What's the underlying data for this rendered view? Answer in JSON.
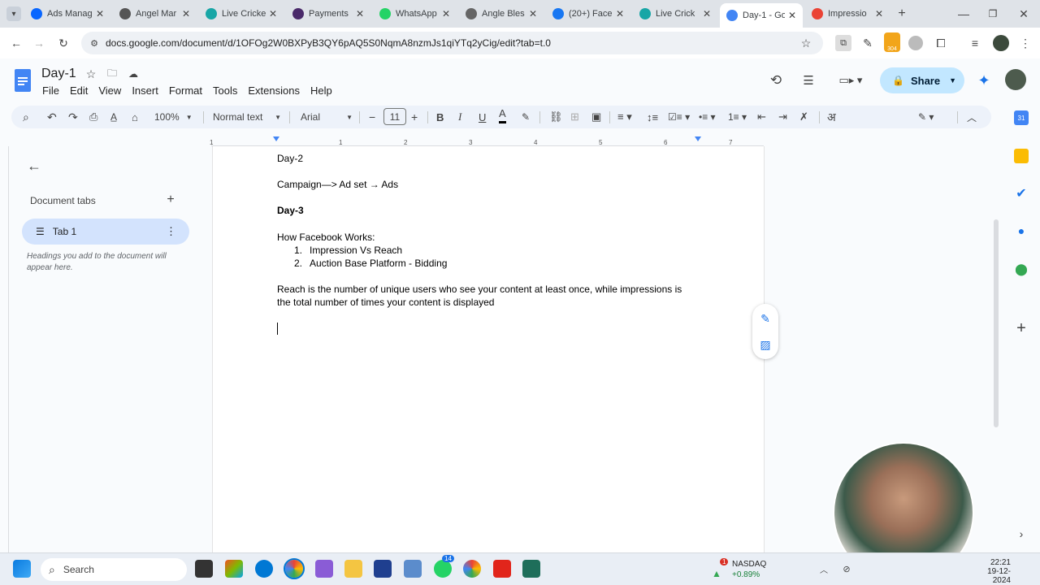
{
  "browser": {
    "tabs": [
      {
        "title": "Ads Manag",
        "color": "#0866ff"
      },
      {
        "title": "Angel Mar",
        "color": "#555"
      },
      {
        "title": "Live Cricke",
        "color": "#18a6a6"
      },
      {
        "title": "Payments",
        "color": "#4a2a6a"
      },
      {
        "title": "WhatsApp",
        "color": "#25d366"
      },
      {
        "title": "Angle Bles",
        "color": "#666"
      },
      {
        "title": "(20+) Face",
        "color": "#1877f2"
      },
      {
        "title": "Live Crick",
        "color": "#18a6a6"
      },
      {
        "title": "Day-1 - Go",
        "color": "#4285f4"
      },
      {
        "title": "Impressio",
        "color": "#ea4335"
      }
    ],
    "url": "docs.google.com/document/d/1OFOg2W0BXPyB3QY6pAQ5S0NqmA8nzmJs1qiYTq2yCig/edit?tab=t.0",
    "badge": "304"
  },
  "doc": {
    "title": "Day-1",
    "menu": [
      "File",
      "Edit",
      "View",
      "Insert",
      "Format",
      "Tools",
      "Extensions",
      "Help"
    ],
    "share_label": "Share"
  },
  "toolbar": {
    "zoom": "100%",
    "style": "Normal text",
    "font": "Arial",
    "font_size": "11"
  },
  "ruler": [
    "1",
    "1",
    "2",
    "3",
    "4",
    "5",
    "6",
    "7"
  ],
  "sidebar": {
    "heading": "Document tabs",
    "tab_label": "Tab 1",
    "hint": "Headings you add to the document will appear here."
  },
  "content": {
    "line1": "Day-2",
    "line2": "Campaign—> Ad set → Ads",
    "line3": "Day-3",
    "line4": "How Facebook Works:",
    "list": [
      {
        "num": "1.",
        "text": "Impression Vs Reach"
      },
      {
        "num": "2.",
        "text": "Auction Base Platform - Bidding"
      }
    ],
    "para1": "Reach is the number of unique users who see your content at least once, while impressions is",
    "para2": "the total number of times your content is displayed"
  },
  "taskbar": {
    "search": "Search",
    "whatsapp_badge": "14",
    "stock_name": "NASDAQ",
    "stock_change": "+0.89%",
    "stock_badge": "1",
    "time": "22:21",
    "date": "19-12-2024"
  }
}
